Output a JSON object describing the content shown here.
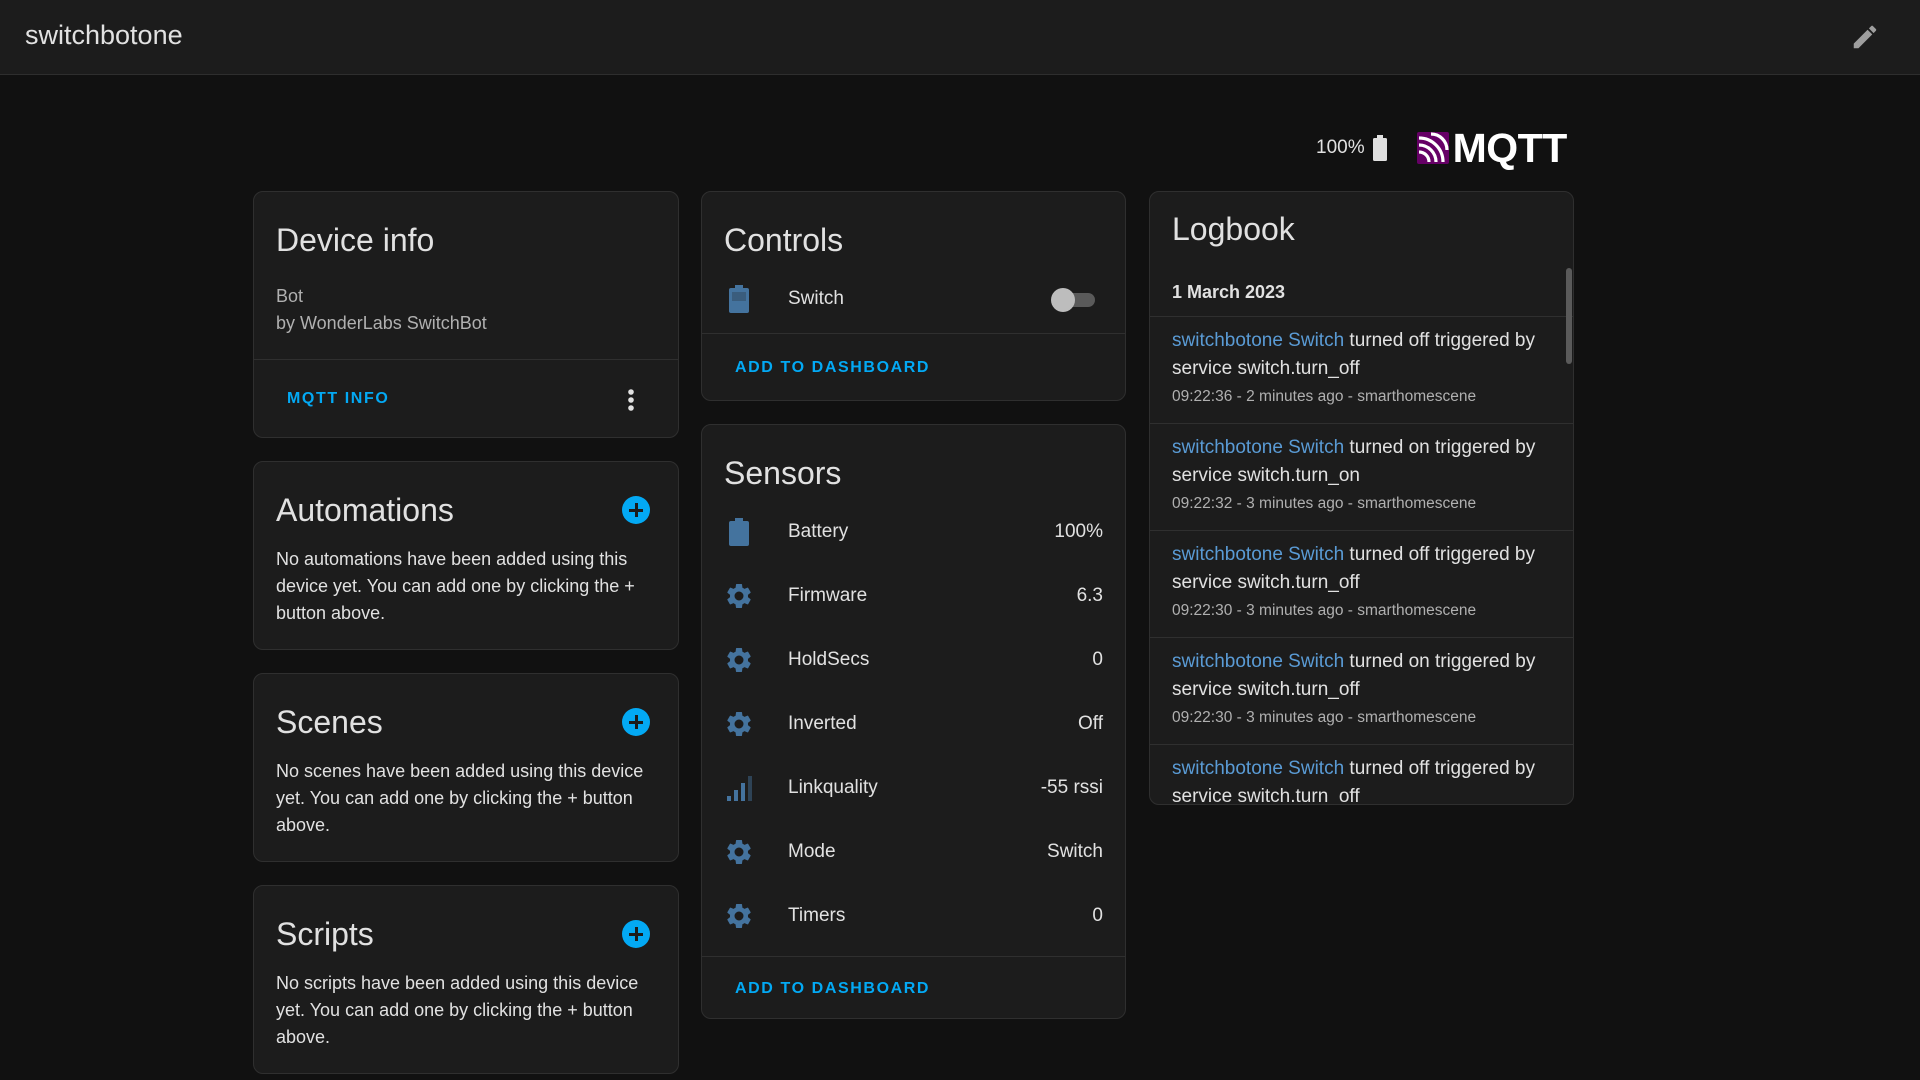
{
  "topbar": {
    "title": "switchbotone",
    "edit_icon": "pencil-icon"
  },
  "header": {
    "battery": "100%",
    "integration_logo": "MQTT"
  },
  "device_info": {
    "title": "Device info",
    "model": "Bot",
    "manufacturer": "by WonderLabs SwitchBot",
    "action_label": "MQTT INFO"
  },
  "automations": {
    "title": "Automations",
    "empty_text": "No automations have been added using this device yet. You can add one by clicking the + button above."
  },
  "scenes": {
    "title": "Scenes",
    "empty_text": "No scenes have been added using this device yet. You can add one by clicking the + button above."
  },
  "scripts": {
    "title": "Scripts",
    "empty_text": "No scripts have been added using this device yet. You can add one by clicking the + button above."
  },
  "controls": {
    "title": "Controls",
    "items": [
      {
        "label": "Switch",
        "icon": "battery-icon",
        "state": "off"
      }
    ],
    "add_label": "ADD TO DASHBOARD"
  },
  "sensors": {
    "title": "Sensors",
    "items": [
      {
        "label": "Battery",
        "value": "100%",
        "icon": "battery-icon"
      },
      {
        "label": "Firmware",
        "value": "6.3",
        "icon": "gear-icon"
      },
      {
        "label": "HoldSecs",
        "value": "0",
        "icon": "gear-icon"
      },
      {
        "label": "Inverted",
        "value": "Off",
        "icon": "gear-icon"
      },
      {
        "label": "Linkquality",
        "value": "-55 rssi",
        "icon": "signal-icon"
      },
      {
        "label": "Mode",
        "value": "Switch",
        "icon": "gear-icon"
      },
      {
        "label": "Timers",
        "value": "0",
        "icon": "gear-icon"
      }
    ],
    "add_label": "ADD TO DASHBOARD"
  },
  "logbook": {
    "title": "Logbook",
    "date": "1 March 2023",
    "entries": [
      {
        "entity": "switchbotone Switch",
        "text": " turned off triggered by service switch.turn_off",
        "meta": "09:22:36 - 2 minutes ago - smarthomescene"
      },
      {
        "entity": "switchbotone Switch",
        "text": " turned on triggered by service switch.turn_on",
        "meta": "09:22:32 - 3 minutes ago - smarthomescene"
      },
      {
        "entity": "switchbotone Switch",
        "text": " turned off triggered by service switch.turn_off",
        "meta": "09:22:30 - 3 minutes ago - smarthomescene"
      },
      {
        "entity": "switchbotone Switch",
        "text": " turned on triggered by service switch.turn_off",
        "meta": "09:22:30 - 3 minutes ago - smarthomescene"
      },
      {
        "entity": "switchbotone Switch",
        "text": " turned off triggered by service switch.turn_off",
        "meta": ""
      }
    ]
  },
  "colors": {
    "accent": "#03a9f4",
    "icon": "#44739e",
    "entity_link": "#5a9bd5",
    "mqtt_purple": "#660066"
  }
}
